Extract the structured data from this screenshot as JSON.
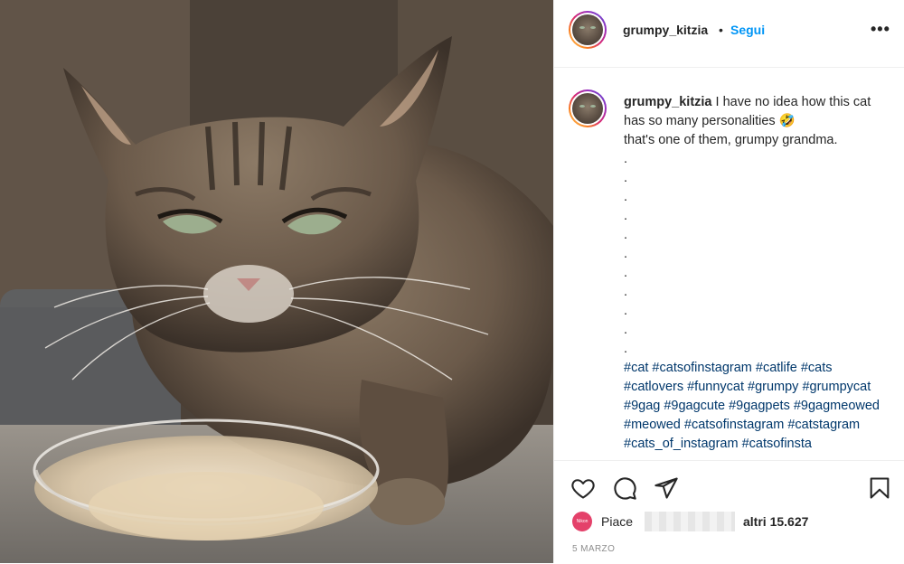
{
  "post": {
    "username": "grumpy_kitzia",
    "dot": "•",
    "follow_label": "Segui",
    "more_icon": "more-horizontal-icon",
    "more_label": "•••",
    "caption": {
      "username": "grumpy_kitzia",
      "text_line1": " I have no idea how this cat has so many personalities 🤣",
      "text_line2": "that's one of them, grumpy grandma.",
      "dots": [
        ".",
        ".",
        ".",
        ".",
        ".",
        ".",
        ".",
        ".",
        ".",
        ".",
        "."
      ],
      "hashtags": "#cat #catsofinstagram #catlife #cats #catlovers #funnycat #grumpy #grumpycat #9gag #9gagcute #9gagpets #9gagmeowed #meowed #catsofinstagram #catstagram #cats_of_instagram #catsofinsta"
    },
    "actions": {
      "like_icon": "heart-icon",
      "comment_icon": "comment-icon",
      "share_icon": "send-icon",
      "save_icon": "bookmark-icon"
    },
    "likes": {
      "avatar_label": "Nikon",
      "prefix": "Piace",
      "suffix": "altri 15.627"
    },
    "date": "5 MARZO"
  },
  "colors": {
    "link_blue": "#0095f6",
    "hashtag_blue": "#00376b",
    "text": "#262626",
    "muted": "#8e8e8e"
  }
}
